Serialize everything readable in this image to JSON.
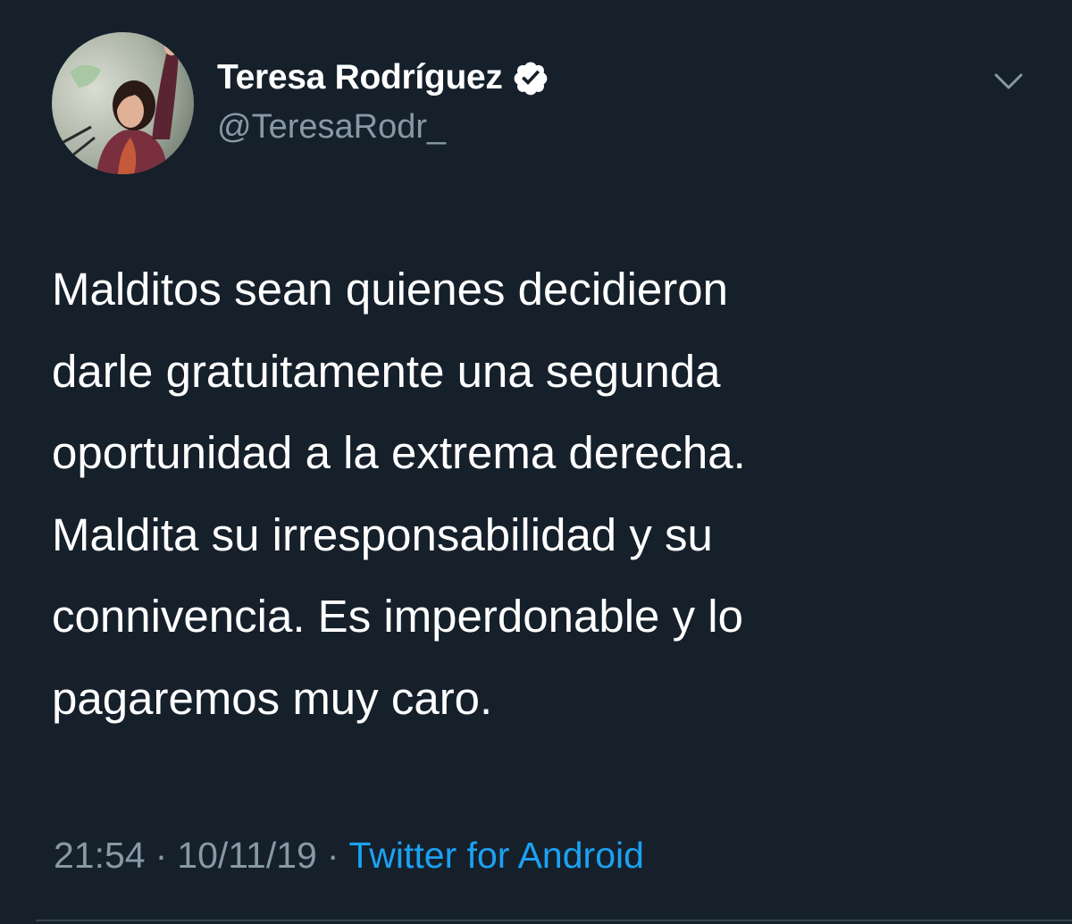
{
  "author": {
    "display_name": "Teresa Rodríguez",
    "handle": "@TeresaRodr_",
    "verified": true
  },
  "tweet": {
    "lines": [
      "Malditos sean quienes decidieron",
      "darle gratuitamente una segunda",
      "oportunidad a la extrema derecha.",
      "Maldita su irresponsabilidad y su",
      "connivencia. Es imperdonable y lo",
      "pagaremos muy caro."
    ]
  },
  "meta": {
    "time": "21:54",
    "date": "10/11/19",
    "separator": "·",
    "source": "Twitter for Android"
  },
  "icons": {
    "verified": "verified-badge-icon",
    "caret": "chevron-down-icon"
  },
  "colors": {
    "background": "#15202b",
    "text": "#ffffff",
    "secondary_text": "#8899a6",
    "link": "#1da1f2"
  }
}
